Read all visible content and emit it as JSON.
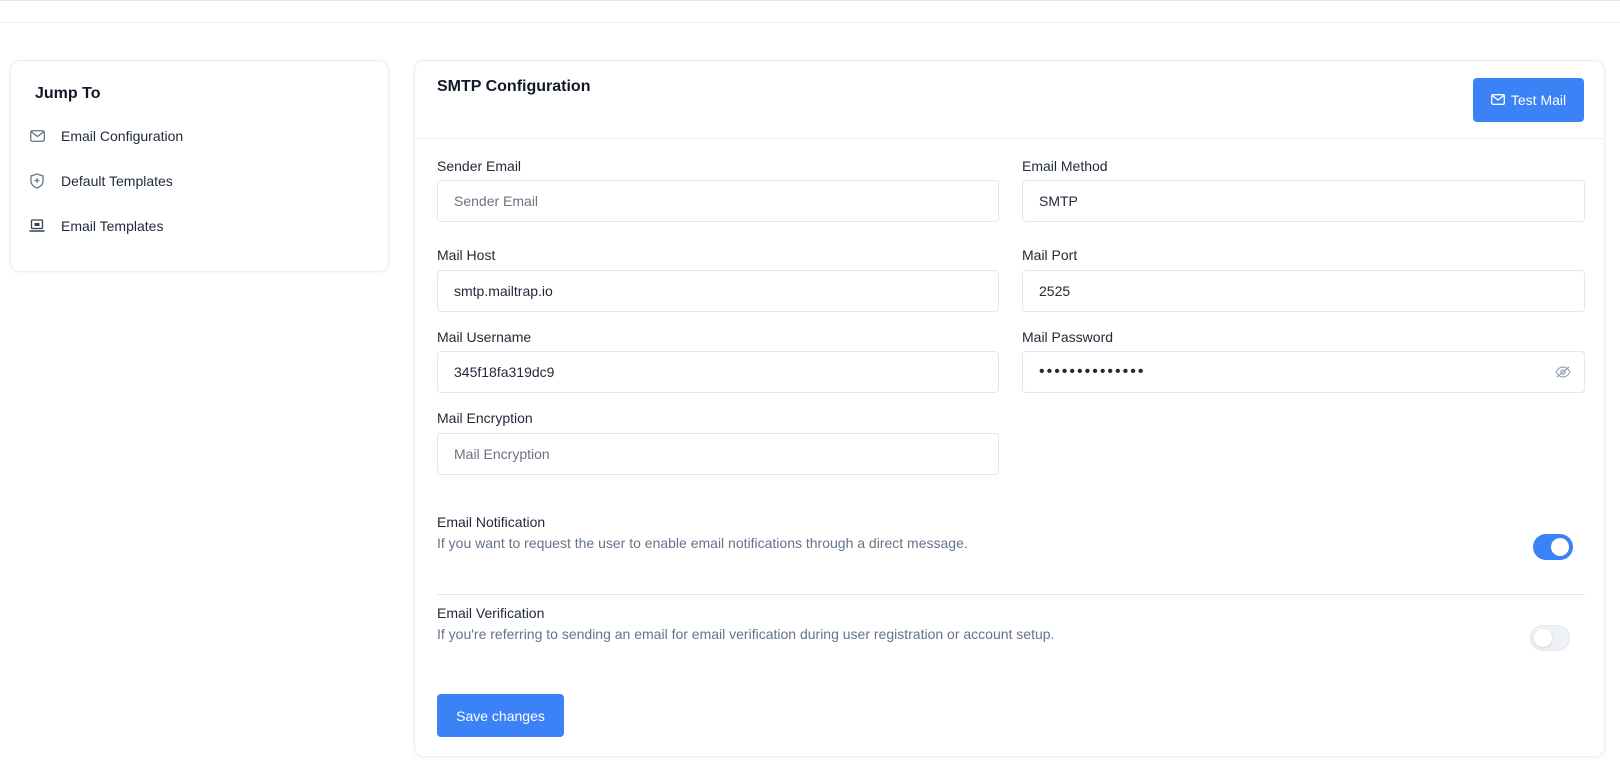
{
  "sidebar": {
    "title": "Jump To",
    "items": [
      {
        "label": "Email Configuration",
        "icon": "envelope-icon"
      },
      {
        "label": "Default Templates",
        "icon": "shield-icon"
      },
      {
        "label": "Email Templates",
        "icon": "laptop-icon"
      }
    ]
  },
  "main": {
    "title": "SMTP Configuration",
    "test_mail_label": "Test Mail",
    "fields": {
      "sender_email": {
        "label": "Sender Email",
        "value": "",
        "placeholder": "Sender Email"
      },
      "email_method": {
        "label": "Email Method",
        "value": "SMTP",
        "placeholder": ""
      },
      "mail_host": {
        "label": "Mail Host",
        "value": "smtp.mailtrap.io",
        "placeholder": ""
      },
      "mail_port": {
        "label": "Mail Port",
        "value": "2525",
        "placeholder": ""
      },
      "mail_username": {
        "label": "Mail Username",
        "value": "345f18fa319dc9",
        "placeholder": ""
      },
      "mail_password": {
        "label": "Mail Password",
        "value": "••••••••••••••",
        "placeholder": ""
      },
      "mail_encryption": {
        "label": "Mail Encryption",
        "value": "",
        "placeholder": "Mail Encryption"
      }
    },
    "toggles": {
      "email_notification": {
        "title": "Email Notification",
        "description": "If you want to request the user to enable email notifications through a direct message.",
        "enabled": true
      },
      "email_verification": {
        "title": "Email Verification",
        "description": "If you're referring to sending an email for email verification during user registration or account setup.",
        "enabled": false
      }
    },
    "save_label": "Save changes"
  },
  "colors": {
    "accent": "#3b82f6",
    "border": "#e5e7eb",
    "muted_text": "#64748b"
  }
}
